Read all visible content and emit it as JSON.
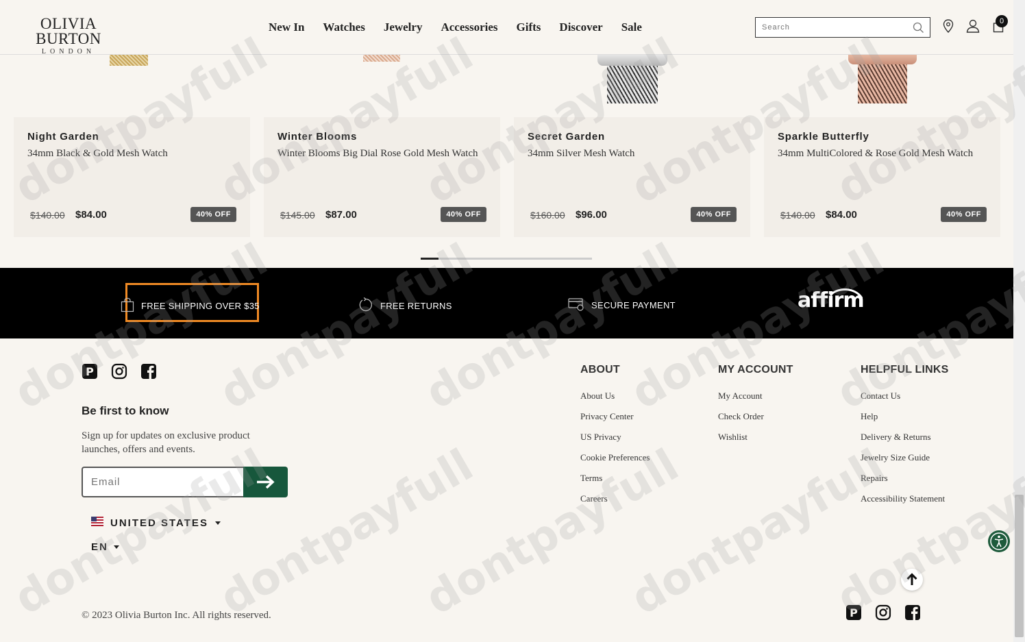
{
  "header": {
    "logo_name": "OLIVIA BURTON",
    "logo_sub": "LONDON",
    "nav": [
      "New In",
      "Watches",
      "Jewelry",
      "Accessories",
      "Gifts",
      "Discover",
      "Sale"
    ],
    "search_placeholder": "Search",
    "cart_count": "0"
  },
  "products": [
    {
      "brand": "Night Garden",
      "title": "34mm Black & Gold Mesh Watch",
      "old_price": "$140.00",
      "price": "$84.00",
      "discount": "40% OFF"
    },
    {
      "brand": "Winter Blooms",
      "title": "Winter Blooms Big Dial Rose Gold Mesh Watch",
      "old_price": "$145.00",
      "price": "$87.00",
      "discount": "40% OFF"
    },
    {
      "brand": "Secret Garden",
      "title": "34mm Silver Mesh Watch",
      "old_price": "$160.00",
      "price": "$96.00",
      "discount": "40% OFF"
    },
    {
      "brand": "Sparkle Butterfly",
      "title": "34mm MultiColored & Rose Gold Mesh Watch",
      "old_price": "$140.00",
      "price": "$84.00",
      "discount": "40% OFF"
    }
  ],
  "benefits": {
    "shipping": "FREE SHIPPING OVER $35",
    "returns": "FREE RETURNS",
    "payment": "SECURE PAYMENT",
    "affirm": "affirm"
  },
  "newsletter": {
    "title": "Be first to know",
    "text": "Sign up for updates on exclusive product launches, offers and events.",
    "email_placeholder": "Email"
  },
  "locale": {
    "country": "UNITED STATES",
    "language": "EN"
  },
  "footer_columns": [
    {
      "heading": "ABOUT",
      "links": [
        "About Us",
        "Privacy Center",
        "US Privacy",
        "Cookie Preferences",
        "Terms",
        "Careers"
      ]
    },
    {
      "heading": "MY ACCOUNT",
      "links": [
        "My Account",
        "Check Order",
        "Wishlist"
      ]
    },
    {
      "heading": "HELPFUL LINKS",
      "links": [
        "Contact Us",
        "Help",
        "Delivery & Returns",
        "Jewelry Size Guide",
        "Repairs",
        "Accessibility Statement"
      ]
    }
  ],
  "copyright": "© 2023 Olivia Burton Inc. All rights reserved.",
  "watermark": "dontpayfull",
  "colors": {
    "accent": "#17573c",
    "highlight": "#f08a24",
    "badge": "#555555"
  }
}
